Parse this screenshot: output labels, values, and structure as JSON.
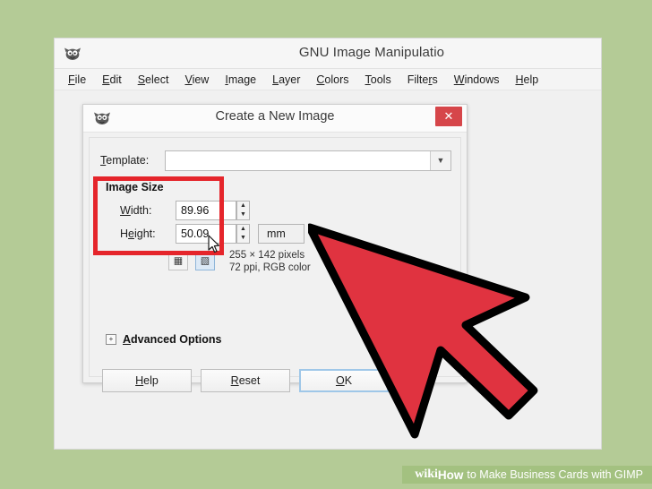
{
  "background_color": "#b4cb96",
  "gimp_window": {
    "title": "GNU Image Manipulatio",
    "app_icon": "gimp-wilber-icon",
    "menus": [
      {
        "label": "File",
        "mnemonic": "F"
      },
      {
        "label": "Edit",
        "mnemonic": "E"
      },
      {
        "label": "Select",
        "mnemonic": "S"
      },
      {
        "label": "View",
        "mnemonic": "V"
      },
      {
        "label": "Image",
        "mnemonic": "I"
      },
      {
        "label": "Layer",
        "mnemonic": "L"
      },
      {
        "label": "Colors",
        "mnemonic": "C"
      },
      {
        "label": "Tools",
        "mnemonic": "T"
      },
      {
        "label": "Filters",
        "mnemonic": "r"
      },
      {
        "label": "Windows",
        "mnemonic": "W"
      },
      {
        "label": "Help",
        "mnemonic": "H"
      }
    ]
  },
  "dialog": {
    "title": "Create a New Image",
    "icon": "gimp-wilber-icon",
    "close_label": "✕",
    "template": {
      "label": "Template:",
      "value": "",
      "placeholder": "",
      "arrow": "▼"
    },
    "image_size": {
      "legend": "Image Size",
      "width": {
        "label": "Width:",
        "value": "89.96"
      },
      "height": {
        "label": "Height:",
        "value": "50.09"
      },
      "unit": "mm",
      "spin_up": "▲",
      "spin_down": "▼",
      "orientation": {
        "portrait_icon": "portrait-orientation-icon",
        "landscape_icon": "landscape-orientation-icon",
        "selected": "landscape"
      },
      "info_line_1": "255 × 142 pixels",
      "info_line_2": "72 ppi, RGB color"
    },
    "advanced_options": {
      "label": "Advanced Options",
      "expander": "+",
      "expanded": false
    },
    "buttons": {
      "help": "Help",
      "reset": "Reset",
      "ok": "OK"
    }
  },
  "annotations": {
    "highlight_color": "#e5252b",
    "big_cursor": "red-arrow-cursor",
    "spinner_cursor": "mouse-pointer-cursor"
  },
  "watermark": {
    "wiki": "wiki",
    "how": "How",
    "text": "to Make Business Cards with GIMP"
  }
}
